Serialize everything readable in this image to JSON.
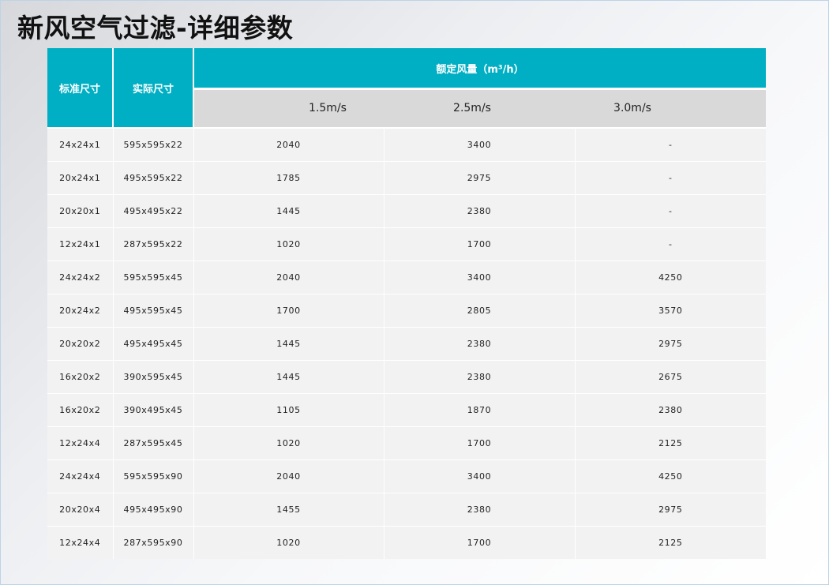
{
  "page": {
    "title": "新风空气过滤-详细参数"
  },
  "table": {
    "headers": {
      "standard_size": "标准尺寸",
      "actual_size": "实际尺寸",
      "rated_airflow": "额定风量（m³/h）",
      "speeds": [
        "1.5m/s",
        "2.5m/s",
        "3.0m/s"
      ]
    },
    "rows": [
      [
        "24x24x1",
        "595x595x22",
        "2040",
        "3400",
        "-"
      ],
      [
        "20x24x1",
        "495x595x22",
        "1785",
        "2975",
        "-"
      ],
      [
        "20x20x1",
        "495x495x22",
        "1445",
        "2380",
        "-"
      ],
      [
        "12x24x1",
        "287x595x22",
        "1020",
        "1700",
        "-"
      ],
      [
        "24x24x2",
        "595x595x45",
        "2040",
        "3400",
        "4250"
      ],
      [
        "20x24x2",
        "495x595x45",
        "1700",
        "2805",
        "3570"
      ],
      [
        "20x20x2",
        "495x495x45",
        "1445",
        "2380",
        "2975"
      ],
      [
        "16x20x2",
        "390x595x45",
        "1445",
        "2380",
        "2675"
      ],
      [
        "16x20x2",
        "390x495x45",
        "1105",
        "1870",
        "2380"
      ],
      [
        "12x24x4",
        "287x595x45",
        "1020",
        "1700",
        "2125"
      ],
      [
        "24x24x4",
        "595x595x90",
        "2040",
        "3400",
        "4250"
      ],
      [
        "20x20x4",
        "495x495x90",
        "1455",
        "2380",
        "2975"
      ],
      [
        "12x24x4",
        "287x595x90",
        "1020",
        "1700",
        "2125"
      ]
    ]
  },
  "colors": {
    "header_teal": "#00afc3",
    "subheader_gray": "#d9d9d9",
    "row_gray": "#f2f2f2"
  }
}
